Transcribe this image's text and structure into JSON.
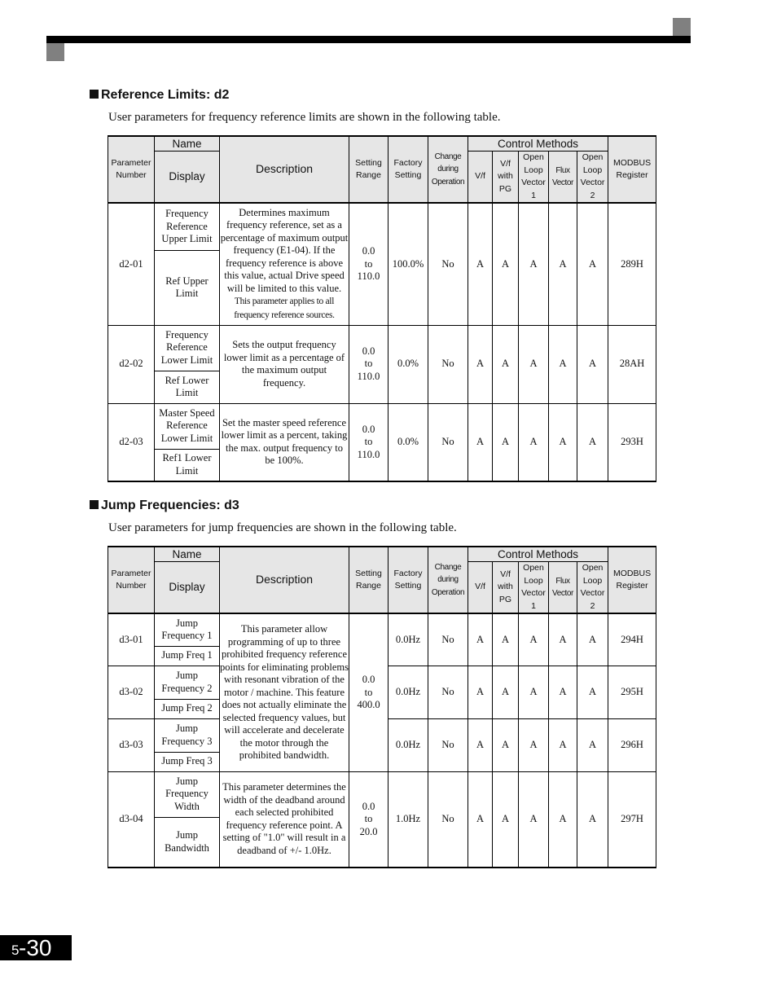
{
  "page": {
    "chapter": "5",
    "page": "-30"
  },
  "sections": [
    {
      "title": "Reference Limits: d2",
      "intro": "User parameters for frequency reference limits are shown in the following table."
    },
    {
      "title": "Jump Frequencies: d3",
      "intro": "User parameters for jump frequencies are shown in the following table."
    }
  ],
  "header": {
    "param_number": "Parameter Number",
    "name": "Name",
    "display": "Display",
    "description": "Description",
    "setting_range": "Setting Range",
    "factory_setting": "Factory Setting",
    "change_during_op": "Change during Operation",
    "control_methods": "Control Methods",
    "vf": "V/f",
    "vf_pg": "V/f with PG",
    "olv1": "Open Loop Vector 1",
    "flux": "Flux Vector",
    "olv2": "Open Loop Vector 2",
    "modbus": "MODBUS Register"
  },
  "d2": [
    {
      "param": "d2-01",
      "name": "Frequency Reference Upper Limit",
      "display": "Ref Upper Limit",
      "desc": "Determines maximum frequency reference, set as a percentage of maximum output frequency (E1-04). If the frequency reference is above this value, actual Drive speed will be limited to this value.",
      "desc_small": "This parameter applies to all frequency reference sources.",
      "range": [
        "0.0",
        "to",
        "110.0"
      ],
      "factory": "100.0%",
      "change": "No",
      "methods": [
        "A",
        "A",
        "A",
        "A",
        "A"
      ],
      "modbus": "289H"
    },
    {
      "param": "d2-02",
      "name": "Frequency Reference Lower Limit",
      "display": "Ref Lower Limit",
      "desc": "Sets the output frequency lower limit as a percentage of the maximum output frequency.",
      "range": [
        "0.0",
        "to",
        "110.0"
      ],
      "factory": "0.0%",
      "change": "No",
      "methods": [
        "A",
        "A",
        "A",
        "A",
        "A"
      ],
      "modbus": "28AH"
    },
    {
      "param": "d2-03",
      "name": "Master Speed Reference Lower Limit",
      "display": "Ref1 Lower Limit",
      "desc": "Set the master speed reference lower limit as a percent, taking the max. output frequency to be 100%.",
      "range": [
        "0.0",
        "to",
        "110.0"
      ],
      "factory": "0.0%",
      "change": "No",
      "methods": [
        "A",
        "A",
        "A",
        "A",
        "A"
      ],
      "modbus": "293H"
    }
  ],
  "d3": {
    "shared_desc": "This parameter allow programming of up to three prohibited frequency reference points for eliminating problems with resonant vibration of the motor / machine. This feature does not actually eliminate the selected frequency values, but will accelerate and decelerate the motor through the prohibited bandwidth.",
    "shared_range": [
      "0.0",
      "to",
      "400.0"
    ],
    "rows": [
      {
        "param": "d3-01",
        "name": "Jump Frequency 1",
        "display": "Jump Freq 1",
        "factory": "0.0Hz",
        "change": "No",
        "methods": [
          "A",
          "A",
          "A",
          "A",
          "A"
        ],
        "modbus": "294H"
      },
      {
        "param": "d3-02",
        "name": "Jump Frequency 2",
        "display": "Jump Freq 2",
        "factory": "0.0Hz",
        "change": "No",
        "methods": [
          "A",
          "A",
          "A",
          "A",
          "A"
        ],
        "modbus": "295H"
      },
      {
        "param": "d3-03",
        "name": "Jump Frequency 3",
        "display": "Jump Freq 3",
        "factory": "0.0Hz",
        "change": "No",
        "methods": [
          "A",
          "A",
          "A",
          "A",
          "A"
        ],
        "modbus": "296H"
      }
    ],
    "width_row": {
      "param": "d3-04",
      "name": "Jump Frequency Width",
      "display": "Jump Bandwidth",
      "desc": "This parameter determines the width of the deadband around each selected prohibited frequency reference point. A setting of \"1.0\" will result in a deadband of +/- 1.0Hz.",
      "range": [
        "0.0",
        "to",
        "20.0"
      ],
      "factory": "1.0Hz",
      "change": "No",
      "methods": [
        "A",
        "A",
        "A",
        "A",
        "A"
      ],
      "modbus": "297H"
    }
  }
}
